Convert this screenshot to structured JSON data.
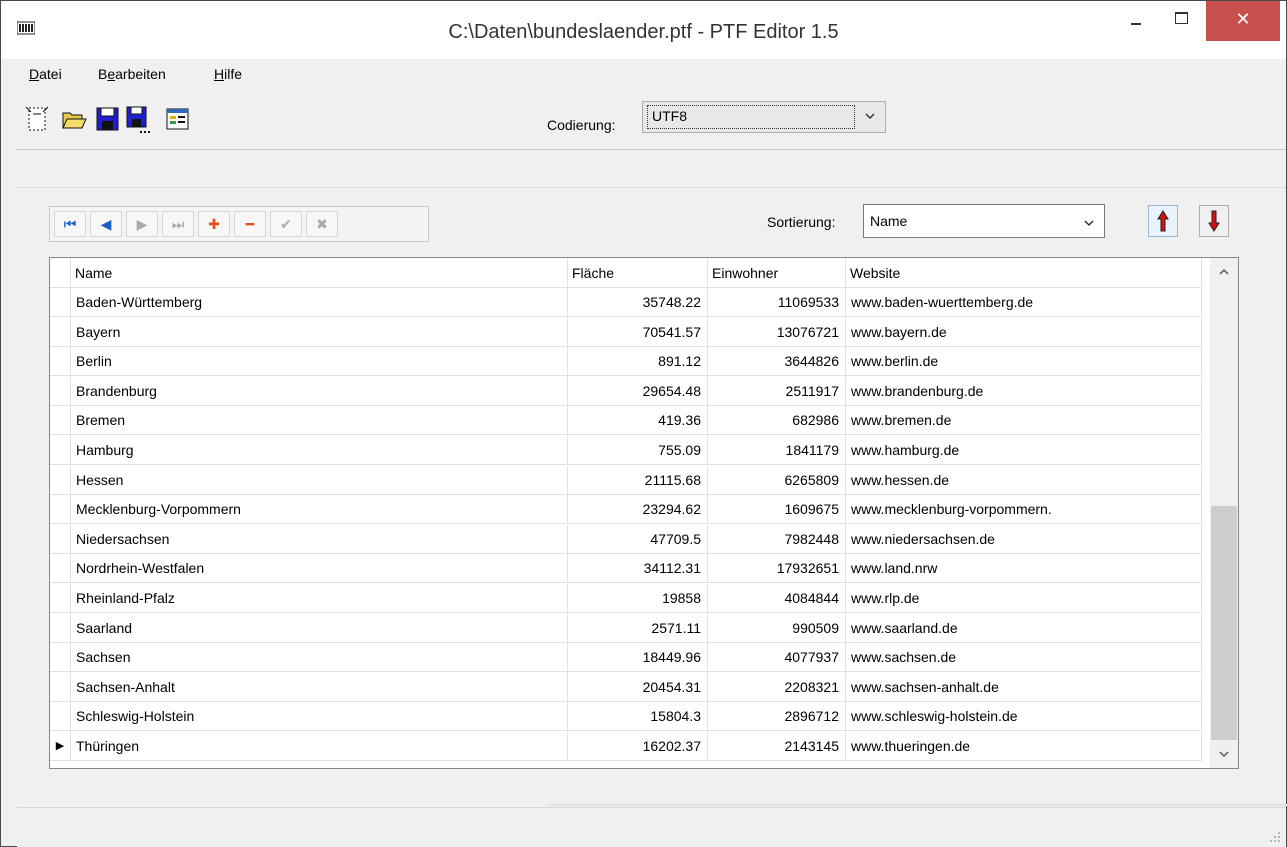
{
  "window": {
    "title": "C:\\Daten\\bundeslaender.ptf - PTF Editor 1.5",
    "close_glyph": "✕"
  },
  "menu": {
    "datei_u": "D",
    "datei_rest": "atei",
    "bearbeiten_pre": "B",
    "bearbeiten_u": "e",
    "bearbeiten_rest": "arbeiten",
    "hilfe_u": "H",
    "hilfe_rest": "ilfe"
  },
  "toolbar": {
    "encoding_label": "Codierung:",
    "encoding_value": "UTF8"
  },
  "navigator": {
    "first": "⏮",
    "prior": "◀",
    "next": "▶",
    "last": "⏭",
    "insert": "✚",
    "delete": "━",
    "post": "✔",
    "cancel": "✖"
  },
  "sort": {
    "label": "Sortierung:",
    "value": "Name"
  },
  "grid": {
    "columns": [
      "Name",
      "Fläche",
      "Einwohner",
      "Website"
    ],
    "current_row_marker": "▶",
    "rows": [
      {
        "name": "Baden-Württemberg",
        "area": "35748.22",
        "pop": "11069533",
        "web": "www.baden-wuerttemberg.de"
      },
      {
        "name": "Bayern",
        "area": "70541.57",
        "pop": "13076721",
        "web": "www.bayern.de"
      },
      {
        "name": "Berlin",
        "area": "891.12",
        "pop": "3644826",
        "web": "www.berlin.de"
      },
      {
        "name": "Brandenburg",
        "area": "29654.48",
        "pop": "2511917",
        "web": "www.brandenburg.de"
      },
      {
        "name": "Bremen",
        "area": "419.36",
        "pop": "682986",
        "web": "www.bremen.de"
      },
      {
        "name": "Hamburg",
        "area": "755.09",
        "pop": "1841179",
        "web": "www.hamburg.de"
      },
      {
        "name": "Hessen",
        "area": "21115.68",
        "pop": "6265809",
        "web": "www.hessen.de"
      },
      {
        "name": "Mecklenburg-Vorpommern",
        "area": "23294.62",
        "pop": "1609675",
        "web": "www.mecklenburg-vorpommern."
      },
      {
        "name": "Niedersachsen",
        "area": "47709.5",
        "pop": "7982448",
        "web": "www.niedersachsen.de"
      },
      {
        "name": "Nordrhein-Westfalen",
        "area": "34112.31",
        "pop": "17932651",
        "web": "www.land.nrw"
      },
      {
        "name": "Rheinland-Pfalz",
        "area": "19858",
        "pop": "4084844",
        "web": "www.rlp.de"
      },
      {
        "name": "Saarland",
        "area": "2571.11",
        "pop": "990509",
        "web": "www.saarland.de"
      },
      {
        "name": "Sachsen",
        "area": "18449.96",
        "pop": "4077937",
        "web": "www.sachsen.de"
      },
      {
        "name": "Sachsen-Anhalt",
        "area": "20454.31",
        "pop": "2208321",
        "web": "www.sachsen-anhalt.de"
      },
      {
        "name": "Schleswig-Holstein",
        "area": "15804.3",
        "pop": "2896712",
        "web": "www.schleswig-holstein.de"
      },
      {
        "name": "Thüringen",
        "area": "16202.37",
        "pop": "2143145",
        "web": "www.thueringen.de"
      }
    ]
  }
}
